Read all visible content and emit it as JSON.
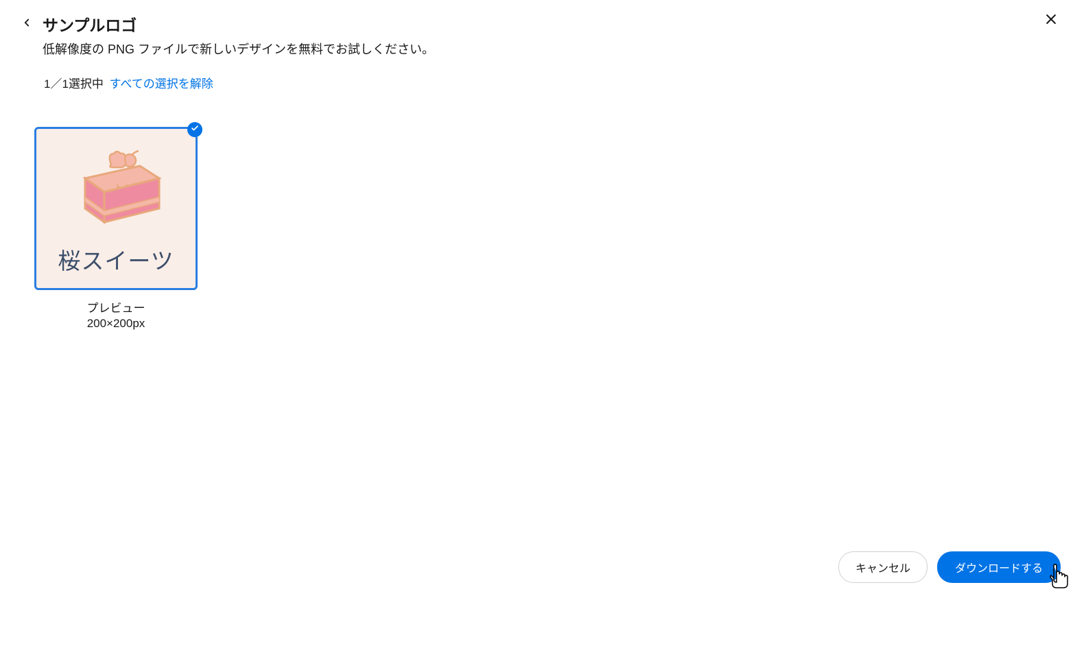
{
  "header": {
    "title": "サンプルロゴ",
    "subtitle": "低解像度の PNG ファイルで新しいデザインを無料でお試しください。"
  },
  "selection": {
    "count_text": "1／1選択中",
    "deselect_label": "すべての選択を解除"
  },
  "thumbnails": [
    {
      "logo_text": "桜スイーツ",
      "label": "プレビュー",
      "size": "200×200px",
      "selected": true
    }
  ],
  "footer": {
    "cancel_label": "キャンセル",
    "download_label": "ダウンロードする"
  }
}
